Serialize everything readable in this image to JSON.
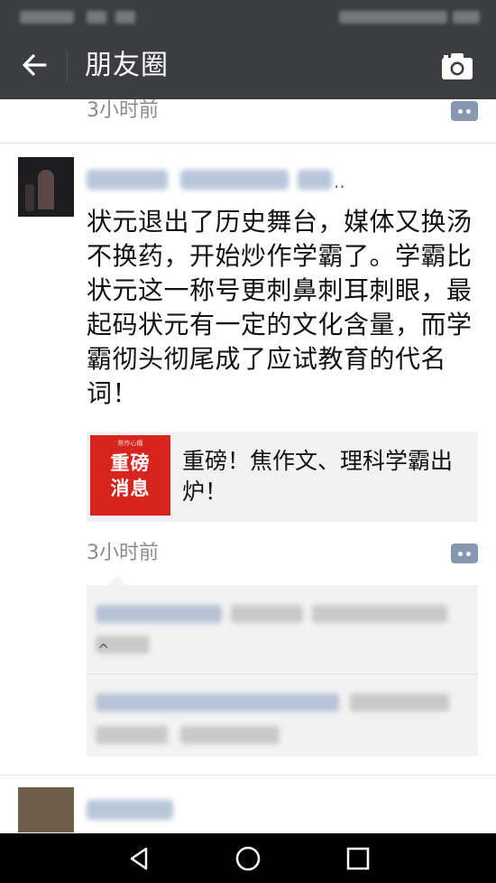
{
  "status_bar": {},
  "header": {
    "title": "朋友圈",
    "back_icon": "back-arrow-icon",
    "camera_icon": "camera-icon"
  },
  "previous_post": {
    "time": "3小时前"
  },
  "post": {
    "text": "状元退出了历史舞台，媒体又换汤不换药，开始炒作学霸了。学霸比状元这一称号更刺鼻刺耳刺眼，最起码状元有一定的文化含量，而学霸彻头彻尾成了应试教育的代名词！",
    "name_ellipsis": "..",
    "share": {
      "thumb_top": "焦作心檀",
      "thumb_line1": "重磅",
      "thumb_line2": "消息",
      "title": "重磅！焦作文、理科学霸出炉！"
    },
    "time": "3小时前",
    "expand_glyph": "^"
  },
  "colors": {
    "bar": "#3b3d41",
    "accent_link": "#576b95",
    "share_red": "#d7241f"
  }
}
